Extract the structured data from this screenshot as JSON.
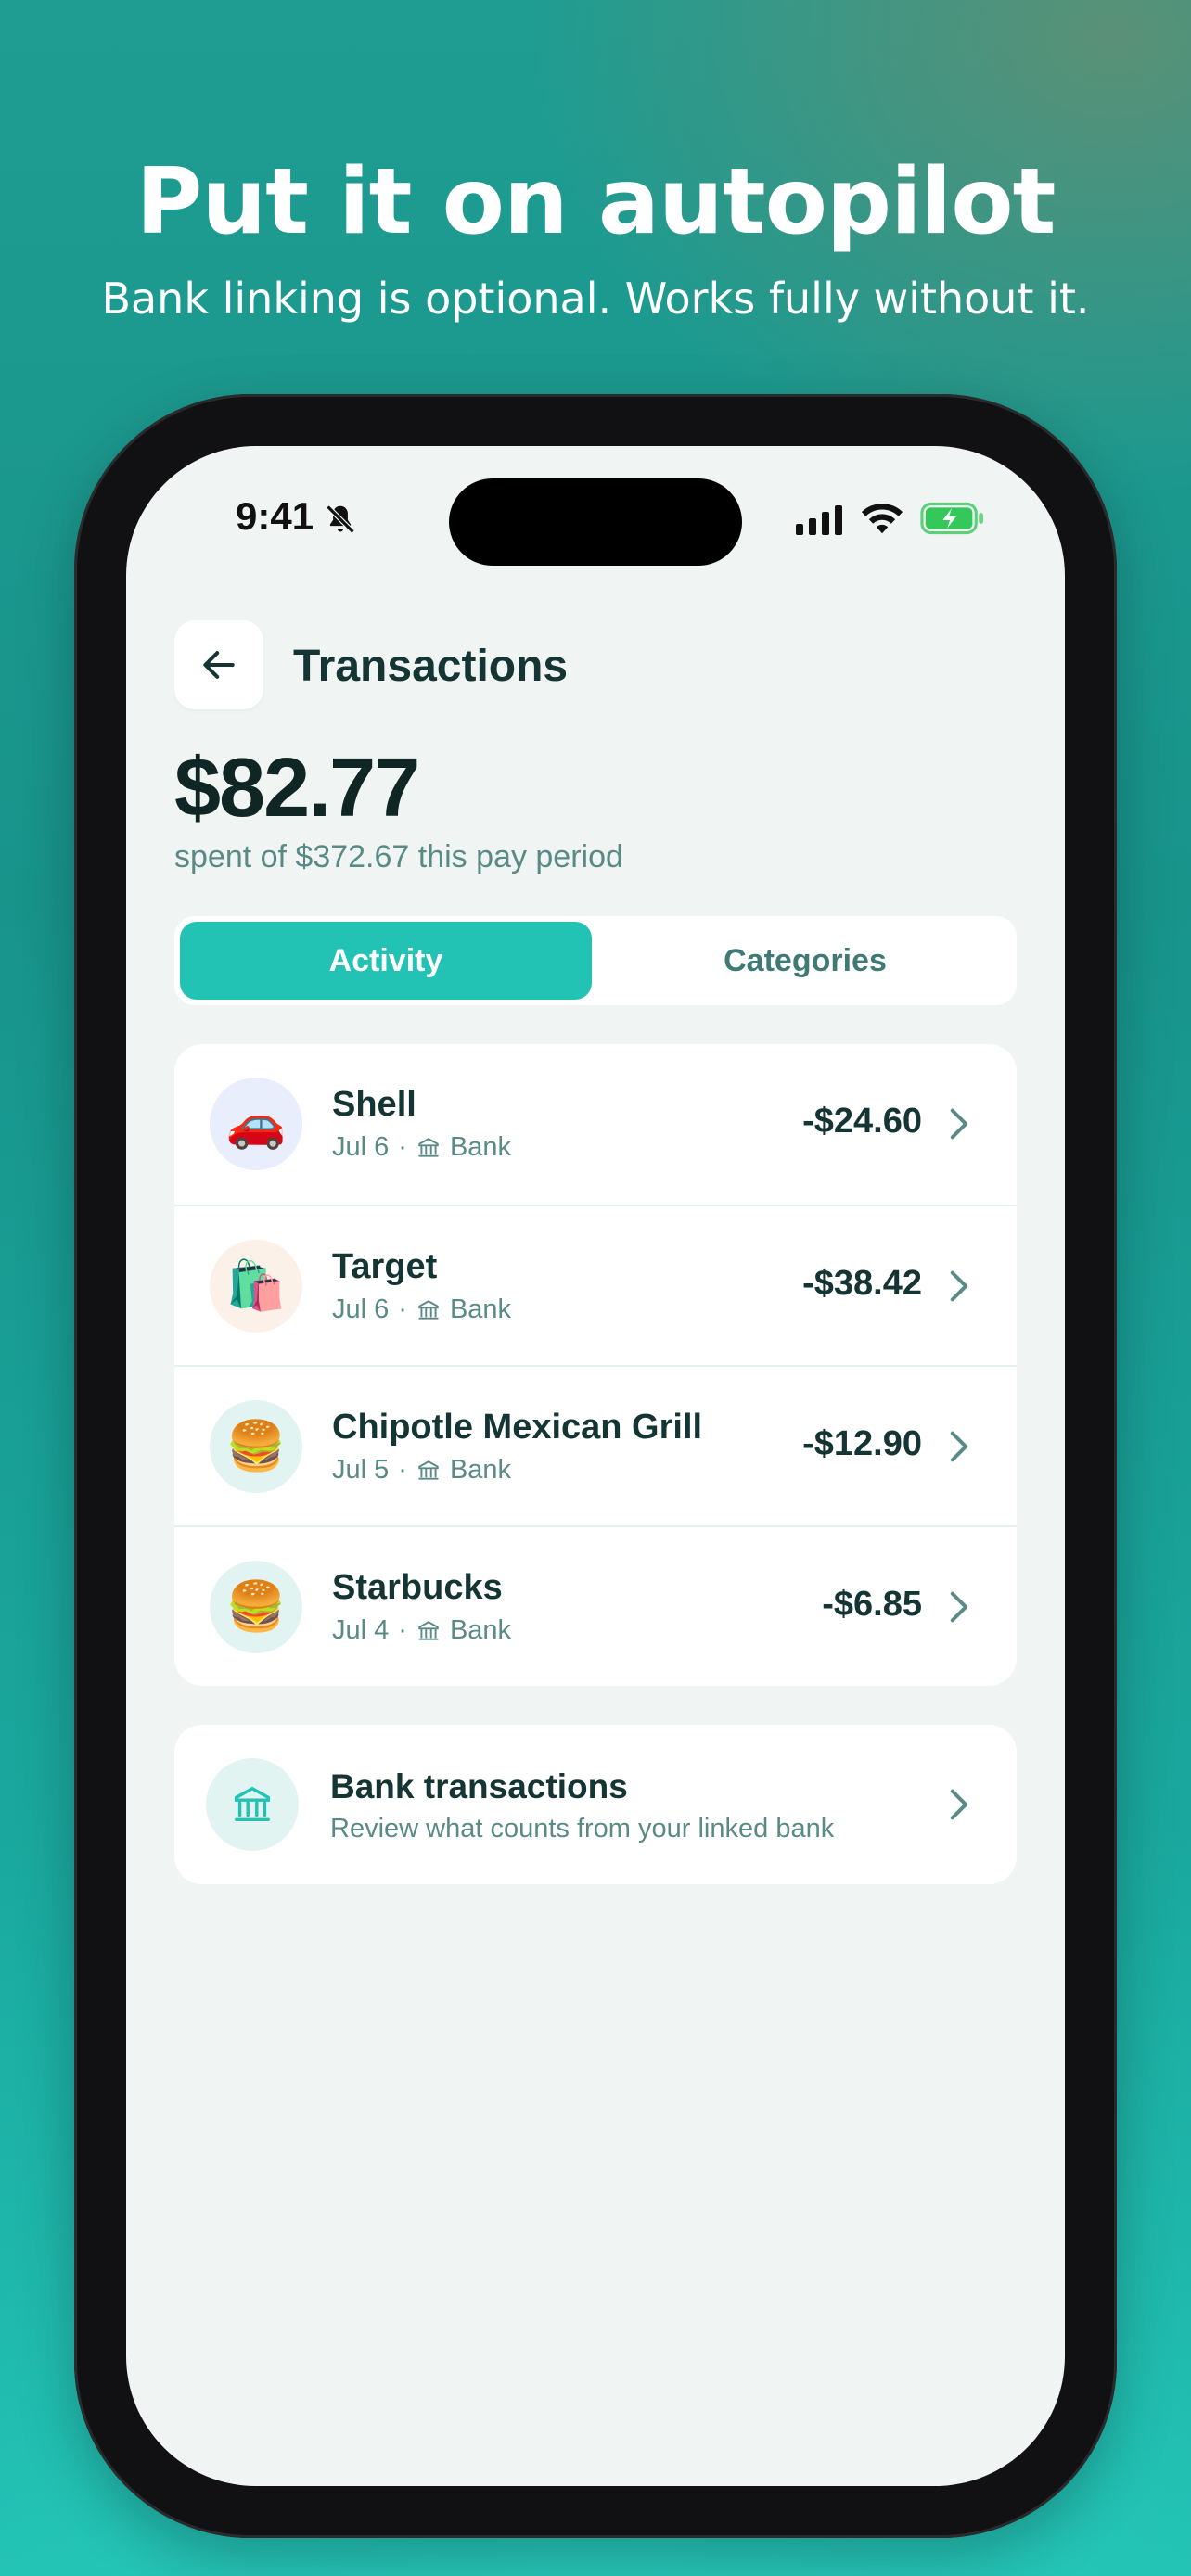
{
  "hero": {
    "title": "Put it on autopilot",
    "subtitle": "Bank linking is optional. Works fully without it."
  },
  "status_bar": {
    "time": "9:41",
    "icons": [
      "bell-slash-icon",
      "signal-icon",
      "wifi-icon",
      "battery-charging-icon"
    ]
  },
  "header": {
    "back_icon": "arrow-left-icon",
    "title": "Transactions"
  },
  "summary": {
    "amount": "$82.77",
    "caption": "spent of $372.67 this pay period"
  },
  "tabs": [
    {
      "label": "Activity",
      "active": true
    },
    {
      "label": "Categories",
      "active": false
    }
  ],
  "transactions": [
    {
      "name": "Shell",
      "date": "Jul 6",
      "separator": "·",
      "source": "Bank",
      "amount": "-$24.60",
      "emoji": "🚗",
      "avatar_bg": "#e8eefc"
    },
    {
      "name": "Target",
      "date": "Jul 6",
      "separator": "·",
      "source": "Bank",
      "amount": "-$38.42",
      "emoji": "🛍️",
      "avatar_bg": "#fbf1e9"
    },
    {
      "name": "Chipotle Mexican Grill",
      "date": "Jul 5",
      "separator": "·",
      "source": "Bank",
      "amount": "-$12.90",
      "emoji": "🍔",
      "avatar_bg": "#e1f4f2"
    },
    {
      "name": "Starbucks",
      "date": "Jul 4",
      "separator": "·",
      "source": "Bank",
      "amount": "-$6.85",
      "emoji": "🍔",
      "avatar_bg": "#e1f4f2"
    }
  ],
  "bank_card": {
    "icon": "bank-icon",
    "title": "Bank transactions",
    "subtitle": "Review what counts from your linked bank"
  },
  "colors": {
    "accent": "#22c2b4",
    "text_dark": "#143533",
    "text_muted": "#5a8a86",
    "screen_bg": "#f0f5f4"
  }
}
